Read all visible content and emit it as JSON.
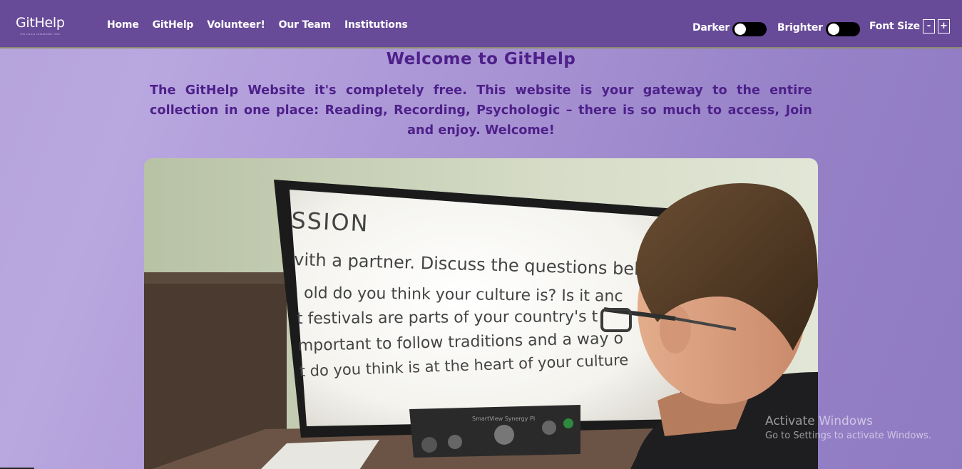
{
  "brand": {
    "name": "GitHelp",
    "tagline": "FOR VISUAL IMPAIRMENT HELP"
  },
  "nav": {
    "links": [
      "Home",
      "GitHelp",
      "Volunteer!",
      "Our Team",
      "Institutions"
    ]
  },
  "controls": {
    "darker_label": "Darker",
    "brighter_label": "Brighter",
    "font_size_label": "Font Size",
    "decrease_label": "-",
    "increase_label": "+"
  },
  "main": {
    "title": "Welcome to GitHelp",
    "intro": "The GitHelp Website it's completely free. This website is your gateway to the entire collection in one place: Reading, Recording, Psychologic – there is so much to access, Join and enjoy. Welcome!"
  },
  "hero": {
    "screen_lines": [
      "SSION",
      "vith a partner. Discuss the questions belov",
      "old do you think your culture is? Is it anc",
      "t festivals are parts of your country's t",
      "mportant to follow traditions and a way o",
      "t do you think is at the heart of your culture"
    ],
    "device_label": "SmartView Synergy PI"
  },
  "watermark": {
    "title": "Activate Windows",
    "subtitle": "Go to Settings to activate Windows."
  },
  "colors": {
    "navbar": "#674a98",
    "heading": "#4e208a",
    "toggle": "#000000"
  }
}
